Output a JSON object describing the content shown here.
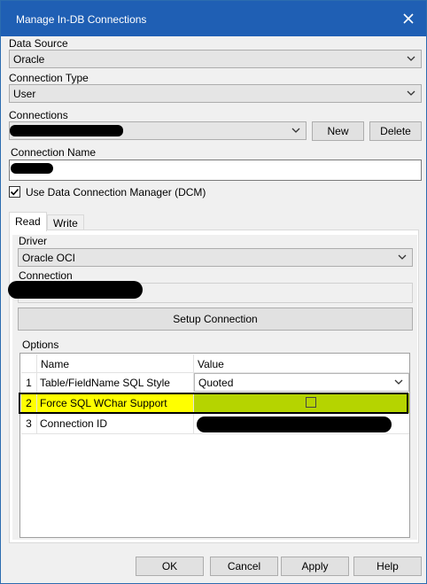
{
  "window": {
    "title": "Manage In-DB Connections"
  },
  "data_source": {
    "label": "Data Source",
    "value": "Oracle"
  },
  "connection_type": {
    "label": "Connection Type",
    "value": "User"
  },
  "connections": {
    "label": "Connections",
    "new_label": "New",
    "delete_label": "Delete"
  },
  "connection_name": {
    "label": "Connection Name"
  },
  "dcm": {
    "label": "Use Data Connection Manager (DCM)",
    "checked": true
  },
  "tabs": [
    {
      "label": "Read",
      "active": true
    },
    {
      "label": "Write",
      "active": false
    }
  ],
  "read": {
    "driver_label": "Driver",
    "driver_value": "Oracle OCI",
    "connection_label": "Connection",
    "setup_label": "Setup Connection"
  },
  "options": {
    "label": "Options",
    "headers": {
      "name": "Name",
      "value": "Value"
    },
    "rows": [
      {
        "num": "1",
        "name": "Table/FieldName SQL Style",
        "value": "Quoted"
      },
      {
        "num": "2",
        "name": "Force SQL WChar Support",
        "value": ""
      },
      {
        "num": "3",
        "name": "Connection ID",
        "value": ""
      }
    ]
  },
  "footer": {
    "ok": "OK",
    "cancel": "Cancel",
    "apply": "Apply",
    "help": "Help"
  },
  "colors": {
    "titlebar": "#1f5fb4",
    "highlight_yellow": "#ffff00",
    "highlight_green": "#b5d400"
  },
  "icons": [
    "close-icon",
    "chevron-down-icon",
    "check-icon"
  ]
}
